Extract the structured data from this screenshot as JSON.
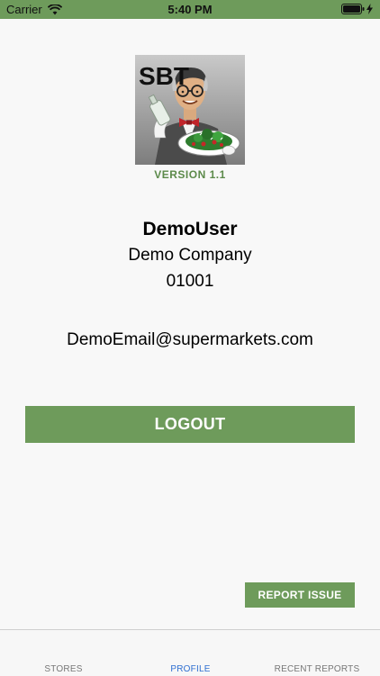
{
  "status_bar": {
    "carrier": "Carrier",
    "time": "5:40 PM",
    "background": "#6e9b5b"
  },
  "profile": {
    "logo_text": "SBT",
    "version": "VERSION 1.1",
    "user_name": "DemoUser",
    "company": "Demo Company",
    "user_id": "01001",
    "email": "DemoEmail@supermarkets.com"
  },
  "actions": {
    "logout_label": "LOGOUT",
    "report_issue_label": "REPORT ISSUE"
  },
  "tabs": [
    {
      "label": "STORES",
      "active": false
    },
    {
      "label": "PROFILE",
      "active": true
    },
    {
      "label": "RECENT REPORTS",
      "active": false
    }
  ],
  "colors": {
    "accent_green": "#6e9b5b",
    "version_green": "#5c8a4a",
    "tab_active": "#2f6fd1",
    "tab_inactive": "#777777"
  }
}
